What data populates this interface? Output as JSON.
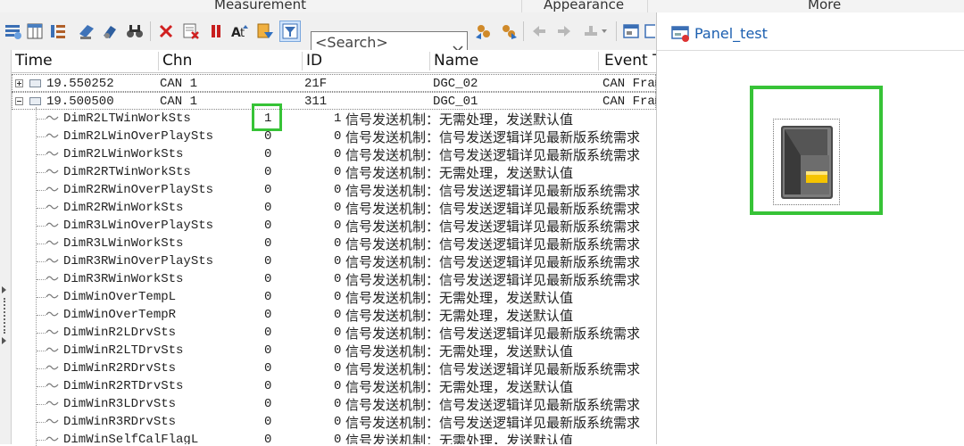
{
  "ribbon": {
    "groups": [
      "Measurement",
      "Appearance",
      "More"
    ]
  },
  "toolbar": {
    "search_placeholder": "<Search>",
    "icons": [
      "filter-icon",
      "columns-icon",
      "sort-icon",
      "highlight-icon",
      "mark-icon",
      "find-icon",
      "delete-icon",
      "clear-filter-icon",
      "pause-icon",
      "timestamp-icon",
      "export-icon",
      "predefined-filter-icon",
      "back-icon",
      "forward-icon",
      "prev-icon",
      "next-icon",
      "options-icon",
      "window-icon"
    ]
  },
  "columns": [
    "Time",
    "Chn",
    "ID",
    "Name",
    "Event Type"
  ],
  "frames": [
    {
      "time": "19.550252",
      "chn": "CAN 1",
      "id": "21F",
      "name": "DGC_02",
      "event": "CAN Frame",
      "expanded": false
    },
    {
      "time": "19.500500",
      "chn": "CAN 1",
      "id": "311",
      "name": "DGC_01",
      "event": "CAN Frame",
      "expanded": true
    }
  ],
  "signals": [
    {
      "name": "DimR2LTWinWorkSts",
      "raw": "1",
      "value": "1",
      "desc": "信号发送机制：无需处理，发送默认值"
    },
    {
      "name": "DimR2LWinOverPlaySts",
      "raw": "0",
      "value": "0",
      "desc": "信号发送机制：信号发送逻辑详见最新版系统需求"
    },
    {
      "name": "DimR2LWinWorkSts",
      "raw": "0",
      "value": "0",
      "desc": "信号发送机制：信号发送逻辑详见最新版系统需求"
    },
    {
      "name": "DimR2RTWinWorkSts",
      "raw": "0",
      "value": "0",
      "desc": "信号发送机制：无需处理，发送默认值"
    },
    {
      "name": "DimR2RWinOverPlaySts",
      "raw": "0",
      "value": "0",
      "desc": "信号发送机制：信号发送逻辑详见最新版系统需求"
    },
    {
      "name": "DimR2RWinWorkSts",
      "raw": "0",
      "value": "0",
      "desc": "信号发送机制：信号发送逻辑详见最新版系统需求"
    },
    {
      "name": "DimR3LWinOverPlaySts",
      "raw": "0",
      "value": "0",
      "desc": "信号发送机制：信号发送逻辑详见最新版系统需求"
    },
    {
      "name": "DimR3LWinWorkSts",
      "raw": "0",
      "value": "0",
      "desc": "信号发送机制：信号发送逻辑详见最新版系统需求"
    },
    {
      "name": "DimR3RWinOverPlaySts",
      "raw": "0",
      "value": "0",
      "desc": "信号发送机制：信号发送逻辑详见最新版系统需求"
    },
    {
      "name": "DimR3RWinWorkSts",
      "raw": "0",
      "value": "0",
      "desc": "信号发送机制：信号发送逻辑详见最新版系统需求"
    },
    {
      "name": "DimWinOverTempL",
      "raw": "0",
      "value": "0",
      "desc": "信号发送机制：无需处理，发送默认值"
    },
    {
      "name": "DimWinOverTempR",
      "raw": "0",
      "value": "0",
      "desc": "信号发送机制：无需处理，发送默认值"
    },
    {
      "name": "DimWinR2LDrvSts",
      "raw": "0",
      "value": "0",
      "desc": "信号发送机制：信号发送逻辑详见最新版系统需求"
    },
    {
      "name": "DimWinR2LTDrvSts",
      "raw": "0",
      "value": "0",
      "desc": "信号发送机制：无需处理，发送默认值"
    },
    {
      "name": "DimWinR2RDrvSts",
      "raw": "0",
      "value": "0",
      "desc": "信号发送机制：信号发送逻辑详见最新版系统需求"
    },
    {
      "name": "DimWinR2RTDrvSts",
      "raw": "0",
      "value": "0",
      "desc": "信号发送机制：无需处理，发送默认值"
    },
    {
      "name": "DimWinR3LDrvSts",
      "raw": "0",
      "value": "0",
      "desc": "信号发送机制：信号发送逻辑详见最新版系统需求"
    },
    {
      "name": "DimWinR3RDrvSts",
      "raw": "0",
      "value": "0",
      "desc": "信号发送机制：信号发送逻辑详见最新版系统需求"
    },
    {
      "name": "DimWinSelfCalFlagL",
      "raw": "0",
      "value": "0",
      "desc": "信号发送机制：无需处理，发送默认值"
    }
  ],
  "panel": {
    "title": "Panel_test",
    "switch_state": "on",
    "switch_lamp_color": "#f5c400"
  },
  "colors": {
    "highlight": "#37c337",
    "panel_title": "#1c5fb0"
  }
}
